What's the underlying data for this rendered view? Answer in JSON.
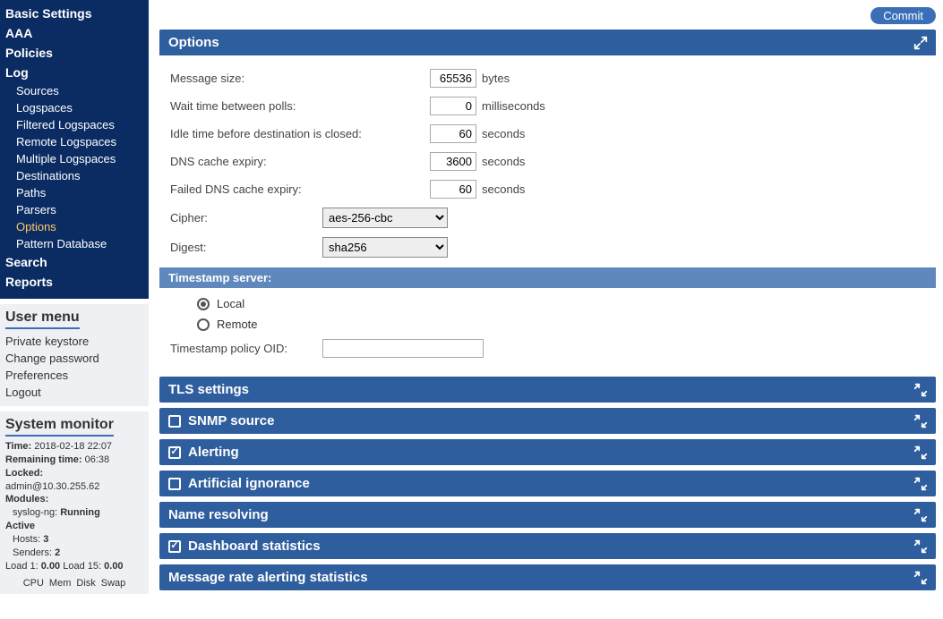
{
  "sidebar": {
    "nav": {
      "items": [
        {
          "label": "Basic Settings",
          "type": "top"
        },
        {
          "label": "AAA",
          "type": "top"
        },
        {
          "label": "Policies",
          "type": "top"
        },
        {
          "label": "Log",
          "type": "top"
        },
        {
          "label": "Sources",
          "type": "sub"
        },
        {
          "label": "Logspaces",
          "type": "sub"
        },
        {
          "label": "Filtered Logspaces",
          "type": "sub"
        },
        {
          "label": "Remote Logspaces",
          "type": "sub"
        },
        {
          "label": "Multiple Logspaces",
          "type": "sub"
        },
        {
          "label": "Destinations",
          "type": "sub"
        },
        {
          "label": "Paths",
          "type": "sub"
        },
        {
          "label": "Parsers",
          "type": "sub"
        },
        {
          "label": "Options",
          "type": "sub",
          "active": true
        },
        {
          "label": "Pattern Database",
          "type": "sub"
        },
        {
          "label": "Search",
          "type": "top"
        },
        {
          "label": "Reports",
          "type": "top"
        }
      ]
    },
    "user_menu": {
      "title": "User menu",
      "items": [
        "Private keystore",
        "Change password",
        "Preferences",
        "Logout"
      ]
    },
    "system_monitor": {
      "title": "System monitor",
      "time_label": "Time:",
      "time_value": "2018-02-18 22:07",
      "remaining_label": "Remaining time:",
      "remaining_value": "06:38",
      "locked_label": "Locked:",
      "locked_value": "admin@10.30.255.62",
      "modules_label": "Modules:",
      "module_name": "syslog-ng:",
      "module_status": "Running",
      "active_label": "Active",
      "hosts_label": "Hosts:",
      "hosts_value": "3",
      "senders_label": "Senders:",
      "senders_value": "2",
      "load1_label": "Load 1:",
      "load1_value": "0.00",
      "load15_label": "Load 15:",
      "load15_value": "0.00",
      "footer": [
        "CPU",
        "Mem",
        "Disk",
        "Swap"
      ]
    }
  },
  "main": {
    "commit_label": "Commit",
    "options_panel": {
      "title": "Options",
      "fields": {
        "message_size": {
          "label": "Message size:",
          "value": "65536",
          "unit": "bytes"
        },
        "wait_time": {
          "label": "Wait time between polls:",
          "value": "0",
          "unit": "milliseconds"
        },
        "idle_time": {
          "label": "Idle time before destination is closed:",
          "value": "60",
          "unit": "seconds"
        },
        "dns_expiry": {
          "label": "DNS cache expiry:",
          "value": "3600",
          "unit": "seconds"
        },
        "failed_dns": {
          "label": "Failed DNS cache expiry:",
          "value": "60",
          "unit": "seconds"
        },
        "cipher": {
          "label": "Cipher:",
          "value": "aes-256-cbc"
        },
        "digest": {
          "label": "Digest:",
          "value": "sha256"
        }
      },
      "timestamp_header": "Timestamp server:",
      "ts_local": "Local",
      "ts_remote": "Remote",
      "ts_oid": {
        "label": "Timestamp policy OID:",
        "value": ""
      }
    },
    "panels": [
      {
        "title": "TLS settings",
        "checkbox": false,
        "checked": false
      },
      {
        "title": "SNMP source",
        "checkbox": true,
        "checked": false
      },
      {
        "title": "Alerting",
        "checkbox": true,
        "checked": true
      },
      {
        "title": "Artificial ignorance",
        "checkbox": true,
        "checked": false
      },
      {
        "title": "Name resolving",
        "checkbox": false,
        "checked": false
      },
      {
        "title": "Dashboard statistics",
        "checkbox": true,
        "checked": true
      },
      {
        "title": "Message rate alerting statistics",
        "checkbox": false,
        "checked": false
      }
    ]
  }
}
